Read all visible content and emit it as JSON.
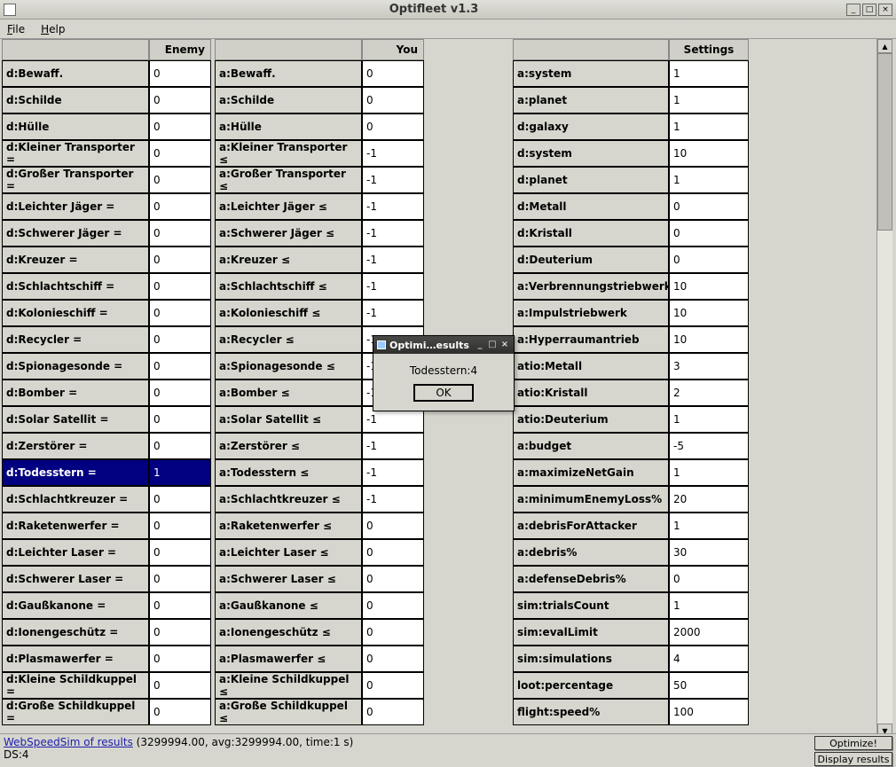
{
  "window": {
    "title": "Optifleet v1.3",
    "minimize": "_",
    "maximize": "□",
    "close": "×"
  },
  "menu": {
    "file": "File",
    "help": "Help"
  },
  "headers": {
    "enemy": "Enemy",
    "you": "You",
    "settings": "Settings"
  },
  "enemy": [
    {
      "label": "d:Bewaff.",
      "val": "0"
    },
    {
      "label": "d:Schilde",
      "val": "0"
    },
    {
      "label": "d:Hülle",
      "val": "0"
    },
    {
      "label": "d:Kleiner Transporter =",
      "val": "0"
    },
    {
      "label": "d:Großer Transporter =",
      "val": "0"
    },
    {
      "label": "d:Leichter Jäger =",
      "val": "0"
    },
    {
      "label": "d:Schwerer Jäger =",
      "val": "0"
    },
    {
      "label": "d:Kreuzer =",
      "val": "0"
    },
    {
      "label": "d:Schlachtschiff =",
      "val": "0"
    },
    {
      "label": "d:Kolonieschiff =",
      "val": "0"
    },
    {
      "label": "d:Recycler =",
      "val": "0"
    },
    {
      "label": "d:Spionagesonde =",
      "val": "0"
    },
    {
      "label": "d:Bomber =",
      "val": "0"
    },
    {
      "label": "d:Solar Satellit =",
      "val": "0"
    },
    {
      "label": "d:Zerstörer =",
      "val": "0"
    },
    {
      "label": "d:Todesstern =",
      "val": "1",
      "selected": true
    },
    {
      "label": "d:Schlachtkreuzer =",
      "val": "0"
    },
    {
      "label": "d:Raketenwerfer =",
      "val": "0"
    },
    {
      "label": "d:Leichter Laser =",
      "val": "0"
    },
    {
      "label": "d:Schwerer Laser =",
      "val": "0"
    },
    {
      "label": "d:Gaußkanone =",
      "val": "0"
    },
    {
      "label": "d:Ionengeschütz =",
      "val": "0"
    },
    {
      "label": "d:Plasmawerfer =",
      "val": "0"
    },
    {
      "label": "d:Kleine Schildkuppel =",
      "val": "0"
    },
    {
      "label": "d:Große Schildkuppel =",
      "val": "0"
    }
  ],
  "you": [
    {
      "label": "a:Bewaff.",
      "val": "0"
    },
    {
      "label": "a:Schilde",
      "val": "0"
    },
    {
      "label": "a:Hülle",
      "val": "0"
    },
    {
      "label": "a:Kleiner Transporter ≤",
      "val": "-1"
    },
    {
      "label": "a:Großer Transporter ≤",
      "val": "-1"
    },
    {
      "label": "a:Leichter Jäger ≤",
      "val": "-1"
    },
    {
      "label": "a:Schwerer Jäger ≤",
      "val": "-1"
    },
    {
      "label": "a:Kreuzer ≤",
      "val": "-1"
    },
    {
      "label": "a:Schlachtschiff ≤",
      "val": "-1"
    },
    {
      "label": "a:Kolonieschiff ≤",
      "val": "-1"
    },
    {
      "label": "a:Recycler ≤",
      "val": "-1"
    },
    {
      "label": "a:Spionagesonde ≤",
      "val": "-1"
    },
    {
      "label": "a:Bomber ≤",
      "val": "-1"
    },
    {
      "label": "a:Solar Satellit ≤",
      "val": "-1"
    },
    {
      "label": "a:Zerstörer ≤",
      "val": "-1"
    },
    {
      "label": "a:Todesstern ≤",
      "val": "-1"
    },
    {
      "label": "a:Schlachtkreuzer ≤",
      "val": "-1"
    },
    {
      "label": "a:Raketenwerfer ≤",
      "val": "0"
    },
    {
      "label": "a:Leichter Laser ≤",
      "val": "0"
    },
    {
      "label": "a:Schwerer Laser ≤",
      "val": "0"
    },
    {
      "label": "a:Gaußkanone ≤",
      "val": "0"
    },
    {
      "label": "a:Ionengeschütz ≤",
      "val": "0"
    },
    {
      "label": "a:Plasmawerfer ≤",
      "val": "0"
    },
    {
      "label": "a:Kleine Schildkuppel ≤",
      "val": "0"
    },
    {
      "label": "a:Große Schildkuppel ≤",
      "val": "0"
    }
  ],
  "settings": [
    {
      "label": "a:system",
      "val": "1"
    },
    {
      "label": "a:planet",
      "val": "1"
    },
    {
      "label": "d:galaxy",
      "val": "1"
    },
    {
      "label": "d:system",
      "val": "10"
    },
    {
      "label": "d:planet",
      "val": "1"
    },
    {
      "label": "d:Metall",
      "val": "0"
    },
    {
      "label": "d:Kristall",
      "val": "0"
    },
    {
      "label": "d:Deuterium",
      "val": "0"
    },
    {
      "label": "a:Verbrennungstriebwerk",
      "val": "10"
    },
    {
      "label": "a:Impulstriebwerk",
      "val": "10"
    },
    {
      "label": "a:Hyperraumantrieb",
      "val": "10"
    },
    {
      "label": "atio:Metall",
      "val": "3"
    },
    {
      "label": "atio:Kristall",
      "val": "2"
    },
    {
      "label": "atio:Deuterium",
      "val": "1"
    },
    {
      "label": "a:budget",
      "val": "-5"
    },
    {
      "label": "a:maximizeNetGain",
      "val": "1"
    },
    {
      "label": "a:minimumEnemyLoss%",
      "val": "20"
    },
    {
      "label": "a:debrisForAttacker",
      "val": "1"
    },
    {
      "label": "a:debris%",
      "val": "30"
    },
    {
      "label": "a:defenseDebris%",
      "val": "0"
    },
    {
      "label": "sim:trialsCount",
      "val": "1"
    },
    {
      "label": "sim:evalLimit",
      "val": "2000"
    },
    {
      "label": "sim:simulations",
      "val": "4"
    },
    {
      "label": "loot:percentage",
      "val": "50"
    },
    {
      "label": "flight:speed%",
      "val": "100"
    }
  ],
  "dialog": {
    "title": "Optimi…esults",
    "body": "Todesstern:4",
    "ok": "OK"
  },
  "footer": {
    "link": "WebSpeedSim of results",
    "stats": " (3299994.00, avg:3299994.00, time:1 s)",
    "ds": "DS:4",
    "optimize": "Optimize!",
    "display": "Display results"
  }
}
